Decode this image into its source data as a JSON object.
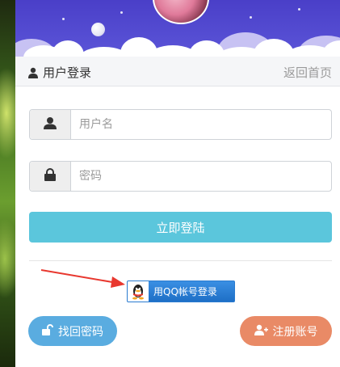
{
  "header": {
    "title": "用户登录",
    "back_home": "返回首页"
  },
  "form": {
    "username": {
      "value": "",
      "placeholder": "用户名"
    },
    "password": {
      "value": "",
      "placeholder": "密码"
    },
    "login_label": "立即登陆",
    "qq_login_label": "用QQ帐号登录",
    "find_password_label": "找回密码",
    "register_label": "注册账号"
  },
  "colors": {
    "banner": "#4a3fc8",
    "login_button": "#5bc6dc",
    "find_password_button": "#5aace0",
    "register_button": "#e98a66",
    "qq_button": "#1e6fc6",
    "annotation_arrow": "#e8382f"
  },
  "icons": {
    "header": "user-icon",
    "username": "user-icon",
    "password": "lock-icon",
    "find_password": "unlock-icon",
    "register": "user-plus-icon",
    "qq": "qq-penguin-icon"
  }
}
